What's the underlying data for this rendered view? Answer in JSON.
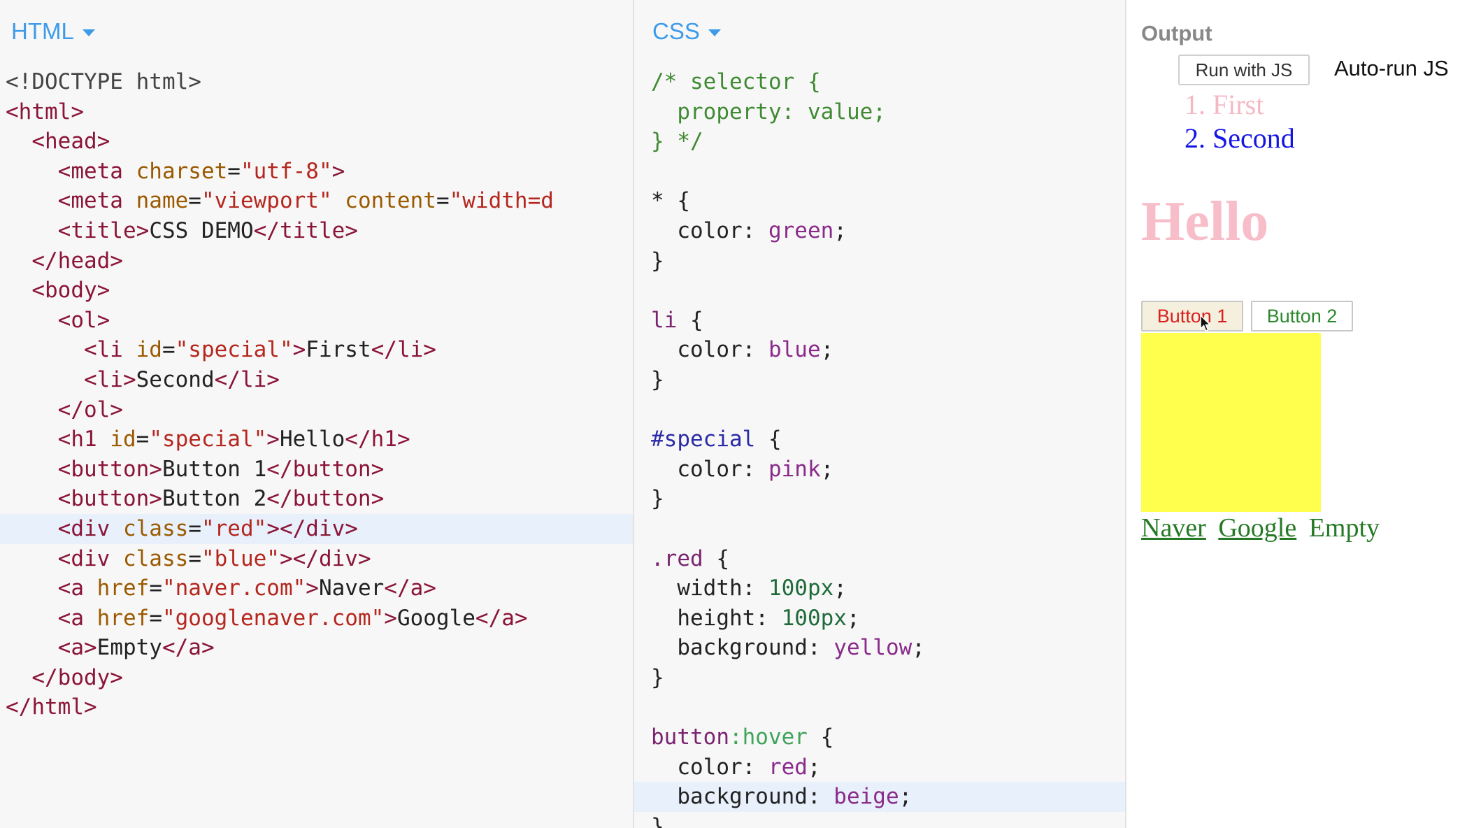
{
  "html_panel": {
    "label": "HTML",
    "lines": [
      [
        [
          "tk-doc",
          "<!DOCTYPE html>"
        ]
      ],
      [
        [
          "tk-tag",
          "<html>"
        ]
      ],
      [
        [
          "tk-txt",
          "  "
        ],
        [
          "tk-tag",
          "<head>"
        ]
      ],
      [
        [
          "tk-txt",
          "    "
        ],
        [
          "tk-tag",
          "<meta "
        ],
        [
          "tk-attr",
          "charset"
        ],
        [
          "tk-txt",
          "="
        ],
        [
          "tk-str",
          "\"utf-8\""
        ],
        [
          "tk-tag",
          ">"
        ]
      ],
      [
        [
          "tk-txt",
          "    "
        ],
        [
          "tk-tag",
          "<meta "
        ],
        [
          "tk-attr",
          "name"
        ],
        [
          "tk-txt",
          "="
        ],
        [
          "tk-str",
          "\"viewport\""
        ],
        [
          "tk-txt",
          " "
        ],
        [
          "tk-attr",
          "content"
        ],
        [
          "tk-txt",
          "="
        ],
        [
          "tk-str",
          "\"width=d"
        ]
      ],
      [
        [
          "tk-txt",
          "    "
        ],
        [
          "tk-tag",
          "<title>"
        ],
        [
          "tk-txt",
          "CSS DEMO"
        ],
        [
          "tk-tag",
          "</title>"
        ]
      ],
      [
        [
          "tk-txt",
          "  "
        ],
        [
          "tk-tag",
          "</head>"
        ]
      ],
      [
        [
          "tk-txt",
          "  "
        ],
        [
          "tk-tag",
          "<body>"
        ]
      ],
      [
        [
          "tk-txt",
          "    "
        ],
        [
          "tk-tag",
          "<ol>"
        ]
      ],
      [
        [
          "tk-txt",
          "      "
        ],
        [
          "tk-tag",
          "<li "
        ],
        [
          "tk-attr",
          "id"
        ],
        [
          "tk-txt",
          "="
        ],
        [
          "tk-str",
          "\"special\""
        ],
        [
          "tk-tag",
          ">"
        ],
        [
          "tk-txt",
          "First"
        ],
        [
          "tk-tag",
          "</li>"
        ]
      ],
      [
        [
          "tk-txt",
          "      "
        ],
        [
          "tk-tag",
          "<li>"
        ],
        [
          "tk-txt",
          "Second"
        ],
        [
          "tk-tag",
          "</li>"
        ]
      ],
      [
        [
          "tk-txt",
          "    "
        ],
        [
          "tk-tag",
          "</ol>"
        ]
      ],
      [
        [
          "tk-txt",
          "    "
        ],
        [
          "tk-tag",
          "<h1 "
        ],
        [
          "tk-attr",
          "id"
        ],
        [
          "tk-txt",
          "="
        ],
        [
          "tk-str",
          "\"special\""
        ],
        [
          "tk-tag",
          ">"
        ],
        [
          "tk-txt",
          "Hello"
        ],
        [
          "tk-tag",
          "</h1>"
        ]
      ],
      [
        [
          "tk-txt",
          "    "
        ],
        [
          "tk-tag",
          "<button>"
        ],
        [
          "tk-txt",
          "Button 1"
        ],
        [
          "tk-tag",
          "</button>"
        ]
      ],
      [
        [
          "tk-txt",
          "    "
        ],
        [
          "tk-tag",
          "<button>"
        ],
        [
          "tk-txt",
          "Button 2"
        ],
        [
          "tk-tag",
          "</button>"
        ]
      ],
      [
        [
          "tk-txt",
          "    "
        ],
        [
          "tk-tag",
          "<div "
        ],
        [
          "tk-attr",
          "class"
        ],
        [
          "tk-txt",
          "="
        ],
        [
          "tk-str",
          "\"red\""
        ],
        [
          "tk-tag",
          "></div>"
        ]
      ],
      [
        [
          "tk-txt",
          "    "
        ],
        [
          "tk-tag",
          "<div "
        ],
        [
          "tk-attr",
          "class"
        ],
        [
          "tk-txt",
          "="
        ],
        [
          "tk-str",
          "\"blue\""
        ],
        [
          "tk-tag",
          "></div>"
        ]
      ],
      [
        [
          "tk-txt",
          "    "
        ],
        [
          "tk-tag",
          "<a "
        ],
        [
          "tk-attr",
          "href"
        ],
        [
          "tk-txt",
          "="
        ],
        [
          "tk-str",
          "\"naver.com\""
        ],
        [
          "tk-tag",
          ">"
        ],
        [
          "tk-txt",
          "Naver"
        ],
        [
          "tk-tag",
          "</a>"
        ]
      ],
      [
        [
          "tk-txt",
          "    "
        ],
        [
          "tk-tag",
          "<a "
        ],
        [
          "tk-attr",
          "href"
        ],
        [
          "tk-txt",
          "="
        ],
        [
          "tk-str",
          "\"googlenaver.com\""
        ],
        [
          "tk-tag",
          ">"
        ],
        [
          "tk-txt",
          "Google"
        ],
        [
          "tk-tag",
          "</a>"
        ]
      ],
      [
        [
          "tk-txt",
          "    "
        ],
        [
          "tk-tag",
          "<a>"
        ],
        [
          "tk-txt",
          "Empty"
        ],
        [
          "tk-tag",
          "</a>"
        ]
      ],
      [
        [
          "tk-txt",
          "  "
        ],
        [
          "tk-tag",
          "</body>"
        ]
      ],
      [
        [
          "tk-tag",
          "</html>"
        ]
      ]
    ],
    "active_line": 15
  },
  "css_panel": {
    "label": "CSS",
    "lines": [
      [
        [
          "tk-comment",
          "/* selector {"
        ]
      ],
      [
        [
          "tk-comment",
          "  property: value;"
        ]
      ],
      [
        [
          "tk-comment",
          "} */"
        ]
      ],
      [
        [
          "tk-txt",
          ""
        ]
      ],
      [
        [
          "tk-punct",
          "* {"
        ]
      ],
      [
        [
          "tk-prop",
          "  color: "
        ],
        [
          "tk-val",
          "green"
        ],
        [
          "tk-punct",
          ";"
        ]
      ],
      [
        [
          "tk-punct",
          "}"
        ]
      ],
      [
        [
          "tk-txt",
          ""
        ]
      ],
      [
        [
          "tk-sel",
          "li"
        ],
        [
          "tk-punct",
          " {"
        ]
      ],
      [
        [
          "tk-prop",
          "  color: "
        ],
        [
          "tk-val",
          "blue"
        ],
        [
          "tk-punct",
          ";"
        ]
      ],
      [
        [
          "tk-punct",
          "}"
        ]
      ],
      [
        [
          "tk-txt",
          ""
        ]
      ],
      [
        [
          "tk-id",
          "#special"
        ],
        [
          "tk-punct",
          " {"
        ]
      ],
      [
        [
          "tk-prop",
          "  color: "
        ],
        [
          "tk-val",
          "pink"
        ],
        [
          "tk-punct",
          ";"
        ]
      ],
      [
        [
          "tk-punct",
          "}"
        ]
      ],
      [
        [
          "tk-txt",
          ""
        ]
      ],
      [
        [
          "tk-sel",
          ".red"
        ],
        [
          "tk-punct",
          " {"
        ]
      ],
      [
        [
          "tk-prop",
          "  width: "
        ],
        [
          "tk-num",
          "100px"
        ],
        [
          "tk-punct",
          ";"
        ]
      ],
      [
        [
          "tk-prop",
          "  height: "
        ],
        [
          "tk-num",
          "100px"
        ],
        [
          "tk-punct",
          ";"
        ]
      ],
      [
        [
          "tk-prop",
          "  background: "
        ],
        [
          "tk-val",
          "yellow"
        ],
        [
          "tk-punct",
          ";"
        ]
      ],
      [
        [
          "tk-punct",
          "}"
        ]
      ],
      [
        [
          "tk-txt",
          ""
        ]
      ],
      [
        [
          "tk-sel",
          "button"
        ],
        [
          "tk-pseudo",
          ":hover"
        ],
        [
          "tk-punct",
          " {"
        ]
      ],
      [
        [
          "tk-prop",
          "  color: "
        ],
        [
          "tk-val",
          "red"
        ],
        [
          "tk-punct",
          ";"
        ]
      ],
      [
        [
          "tk-prop",
          "  background: "
        ],
        [
          "tk-val",
          "beige"
        ],
        [
          "tk-punct",
          ";"
        ]
      ],
      [
        [
          "tk-punct",
          "}"
        ]
      ]
    ],
    "active_line": 24
  },
  "output_panel": {
    "title": "Output",
    "run_button": "Run with JS",
    "autorun_label": "Auto-run JS",
    "list_items": [
      "1. First",
      "2. Second"
    ],
    "heading": "Hello",
    "button1": "Button 1",
    "button2": "Button 2",
    "links": [
      "Naver",
      "Google"
    ],
    "empty_link": "Empty"
  },
  "colors": {
    "accent": "#3d9be9",
    "yellow_box": "#ffff4d",
    "hover_bg": "#f5f0dd",
    "hover_text": "#d92020"
  }
}
